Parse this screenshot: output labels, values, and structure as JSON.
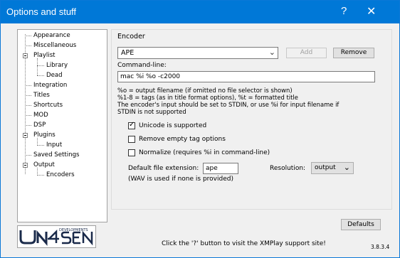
{
  "window": {
    "title": "Options and stuff",
    "help_label": "?",
    "close_label": "✕"
  },
  "tree": {
    "items": [
      {
        "label": "Appearance"
      },
      {
        "label": "Miscellaneous"
      },
      {
        "label": "Playlist"
      },
      {
        "label": "Library"
      },
      {
        "label": "Dead"
      },
      {
        "label": "Integration"
      },
      {
        "label": "Titles"
      },
      {
        "label": "Shortcuts"
      },
      {
        "label": "MOD"
      },
      {
        "label": "DSP"
      },
      {
        "label": "Plugins"
      },
      {
        "label": "Input"
      },
      {
        "label": "Saved Settings"
      },
      {
        "label": "Output"
      },
      {
        "label": "Encoders"
      }
    ],
    "selected": "Encoders"
  },
  "logo": {
    "text_top": "DEVELOPMENTS",
    "text_main": "UN4SEEN"
  },
  "encoder": {
    "group_title": "Encoder",
    "selected": "APE",
    "add_label": "Add",
    "remove_label": "Remove",
    "cmd_label": "Command-line:",
    "cmd_value": "mac %i %o -c2000",
    "info_lines": [
      "%o = output filename (if omitted no file selector is shown)",
      "%1-8 = tags (as in title format options), %t = formatted title",
      "The encoder's input should be set to STDIN, or use %i for input filename if",
      "STDIN is not supported"
    ],
    "unicode_label": "Unicode is supported",
    "unicode_checked": true,
    "remove_tag_label": "Remove empty tag options",
    "remove_tag_checked": false,
    "normalize_label": "Normalize (requires %i in command-line)",
    "normalize_checked": false,
    "ext_label": "Default file extension:",
    "ext_value": "ape",
    "ext_note": "(WAV is used if none is provided)",
    "resolution_label": "Resolution:",
    "resolution_value": "output"
  },
  "footer": {
    "defaults_label": "Defaults",
    "hint": "Click the '?' button to visit the XMPlay support site!",
    "version": "3.8.3.4"
  }
}
